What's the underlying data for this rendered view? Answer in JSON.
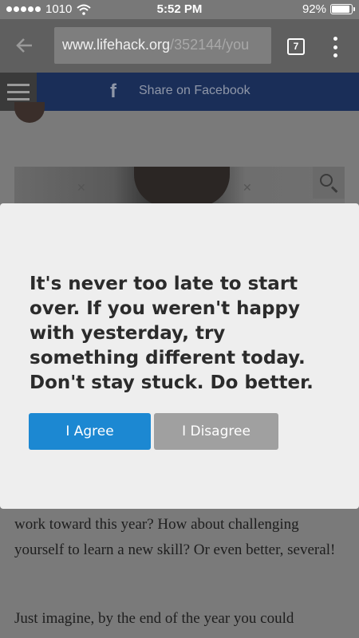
{
  "status_bar": {
    "carrier": "1010",
    "time": "5:52 PM",
    "battery": "92%",
    "battery_level": 0.92
  },
  "browser": {
    "url_domain": "www.lifehack.org",
    "url_path": "/352144/you",
    "tab_count": "7",
    "back_icon": "arrow-left-icon",
    "menu_icon": "more-vertical-icon"
  },
  "header": {
    "share_label": "Share on Facebook",
    "fb_icon": "f",
    "menu_icon": "hamburger-icon",
    "search_icon": "search-icon"
  },
  "article": {
    "paragraph_1": "work toward this year? How about challenging yourself to learn a new skill? Or even better, several!",
    "paragraph_2": "Just imagine, by the end of the year you could"
  },
  "modal": {
    "message": "It's never too late to start over. If you weren't happy with yesterday, try something different today. Don't stay stuck. Do better.",
    "agree_label": "I Agree",
    "disagree_label": "I Disagree",
    "agree_color": "#1c88d2",
    "disagree_color": "#a0a0a0"
  }
}
